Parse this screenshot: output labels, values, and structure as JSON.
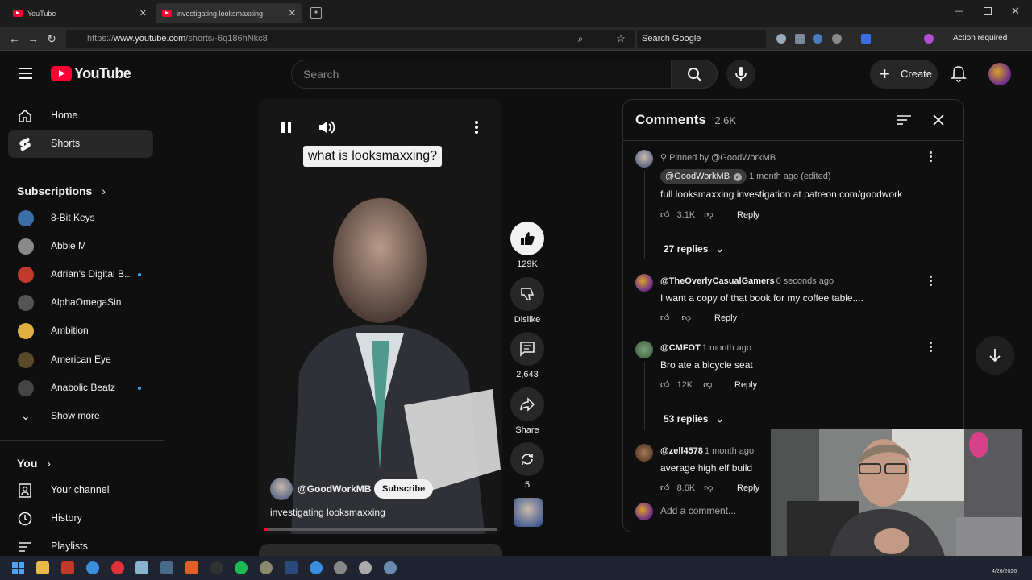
{
  "browser": {
    "tabs": [
      {
        "title": "YouTube"
      },
      {
        "title": "investigating looksmaxxing"
      }
    ],
    "url_prefix": "https://",
    "url_host": "www.youtube.com",
    "url_path": "/shorts/-6q186hNkc8",
    "search_engine_label": "Search Google",
    "action_required": "Action required"
  },
  "header": {
    "logo_text": "YouTube",
    "search_placeholder": "Search",
    "create_label": "Create"
  },
  "sidebar": {
    "home_label": "Home",
    "shorts_label": "Shorts",
    "subscriptions_title": "Subscriptions",
    "subscriptions": [
      {
        "name": "8-Bit Keys",
        "color": "#3a6ea5",
        "new": false
      },
      {
        "name": "Abbie M",
        "color": "#8a8a8a",
        "new": false
      },
      {
        "name": "Adrian's Digital B...",
        "color": "#c0392b",
        "new": true
      },
      {
        "name": "AlphaOmegaSin",
        "color": "#555555",
        "new": false
      },
      {
        "name": "Ambition",
        "color": "#e0b040",
        "new": false
      },
      {
        "name": "American Eye",
        "color": "#5a4a2a",
        "new": false
      },
      {
        "name": "Anabolic Beatz",
        "color": "#444444",
        "new": true
      }
    ],
    "show_more_label": "Show more",
    "you_title": "You",
    "your_channel_label": "Your channel",
    "history_label": "History",
    "playlists_label": "Playlists"
  },
  "short": {
    "caption": "what is looksmaxxing?",
    "channel": "@GoodWorkMB",
    "subscribe_label": "Subscribe",
    "title": "investigating looksmaxxing",
    "likes": "129K",
    "dislike_label": "Dislike",
    "comments_count": "2,643",
    "share_label": "Share",
    "remix_count": "5",
    "progress_fraction": 0.02
  },
  "comments": {
    "title": "Comments",
    "count": "2.6K",
    "add_placeholder": "Add a comment...",
    "reply_label": "Reply",
    "items": [
      {
        "pinned": "Pinned by @GoodWorkMB",
        "author": "@GoodWorkMB",
        "time": "1 month ago (edited)",
        "text": "full looksmaxxing investigation at patreon.com/goodwork",
        "likes": "3.1K",
        "replies": "27 replies"
      },
      {
        "author": "@TheOverlyCasualGamers",
        "time": "0 seconds ago",
        "text": "I want a copy of that book for my coffee table....",
        "likes": ""
      },
      {
        "author": "@CMFOT",
        "time": "1 month ago",
        "text": "Bro ate a bicycle seat",
        "likes": "12K",
        "replies": "53 replies"
      },
      {
        "author": "@zell4578",
        "time": "1 month ago",
        "text": "average high elf build",
        "likes": "8.6K"
      }
    ]
  },
  "taskbar": {
    "date": "4/26/2026"
  },
  "colors": {
    "youtube_red": "#ff0033",
    "background": "#0f0f0f",
    "link_blue": "#3ea6ff"
  }
}
